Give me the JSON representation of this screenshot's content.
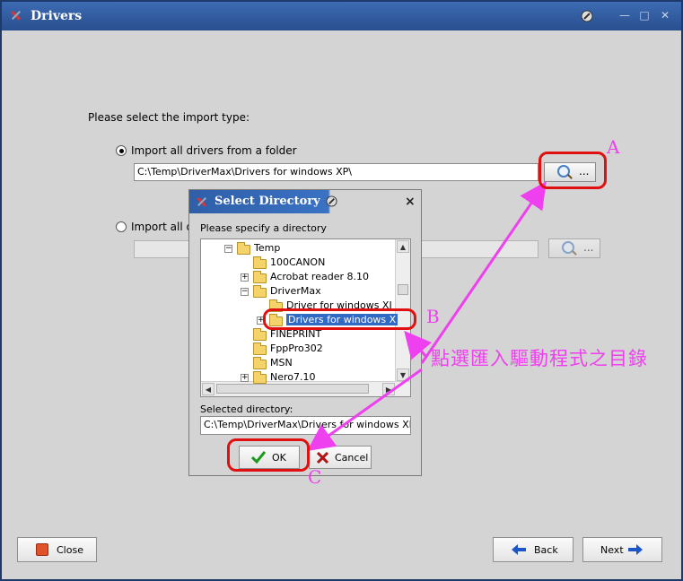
{
  "window": {
    "title": "Drivers"
  },
  "main": {
    "prompt": "Please select the import type:",
    "option_folder_label": "Import all drivers from a folder",
    "option_folder_path": "C:\\Temp\\DriverMax\\Drivers for windows XP\\",
    "option_other_label": "Import all d",
    "browse_label": "..."
  },
  "dialog": {
    "title": "Select Directory",
    "close": "×",
    "prompt": "Please specify a directory",
    "tree": [
      {
        "label": "Temp",
        "expander": "minus"
      },
      {
        "label": "100CANON",
        "expander": ""
      },
      {
        "label": "Acrobat reader 8.10",
        "expander": "plus"
      },
      {
        "label": "DriverMax",
        "expander": "minus"
      },
      {
        "label": "Driver for windows XI",
        "expander": ""
      },
      {
        "label": "Drivers for windows X",
        "expander": "plus"
      },
      {
        "label": "FINEPRINT",
        "expander": ""
      },
      {
        "label": "FppPro302",
        "expander": ""
      },
      {
        "label": "MSN",
        "expander": ""
      },
      {
        "label": "Nero7.10",
        "expander": "plus"
      }
    ],
    "selected_label": "Selected directory:",
    "selected_value": "C:\\Temp\\DriverMax\\Drivers for windows XP",
    "ok": "OK",
    "cancel": "Cancel"
  },
  "footer": {
    "close": "Close",
    "back": "Back",
    "next": "Next"
  },
  "annotations": {
    "a": "A",
    "b": "B",
    "c": "C",
    "note": "點選匯入驅動程式之目錄",
    "color": "#ee40ee",
    "box_color": "#e01010"
  },
  "colors": {
    "titlebar": "#294f8e",
    "selection": "#316ac5",
    "window_bg": "#d4d4d4"
  }
}
